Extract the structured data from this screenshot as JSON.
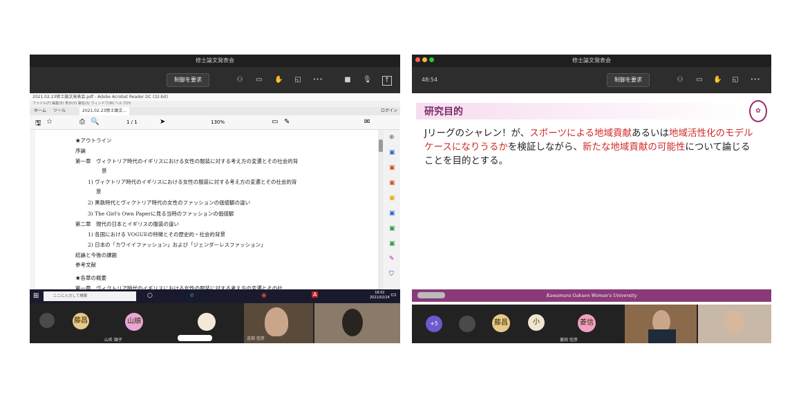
{
  "left": {
    "title": "修士論文発表会",
    "control_btn": "制御を要求",
    "pdf": {
      "strip1": "2021.02.23修士論文発表会.pdf - Adobe Acrobat Reader DC (32-bit)",
      "strip2": "ファイル(F) 編集(E) 表示(V) 署名(S) ウィンドウ(W) ヘルプ(H)",
      "tab_home": "ホーム",
      "tab_tool": "ツール",
      "tab_doc": "2021.02.23修士論文...",
      "login": "ログイン",
      "page": "1 / 1",
      "zoom": "130%",
      "lines": [
        "★アウトライン",
        "序論",
        "第一章　ヴィクトリア時代のイギリスにおける女性の服装に対する考え方の変遷とその社会的背",
        "景",
        "1) ヴィクトリア時代のイギリスにおける女性の服装に対する考え方の変遷とその社会的背",
        "景",
        "2) 黒鉄時代とヴィクトリア時代の女性のファッションの価値観の違い",
        "3) The Girl's Own Paperに見る当時のファッションの価値観",
        "第二章　現代の日本とイギリスの服装の違い",
        "1) 各国における VOGUEの特徴とその歴史的・社会的背景",
        "2) 日本の「カワイイファッション」および「ジェンダーレスファッション」",
        "結論と今後の課題",
        "参考文献",
        "",
        "★各章の概要",
        "第一章　ヴィクトリア時代のイギリスにおける女性の服装に対する考え方の変遷とその社"
      ]
    },
    "taskbar_search": "ここに入力して検索",
    "taskbar_time": "18:02",
    "taskbar_date": "2021/02/24",
    "participants": [
      {
        "initials": "藤昌"
      },
      {
        "initials": "山順",
        "name": "山名 順子"
      },
      {
        "initials": ""
      },
      {
        "name": "吉田 信彦"
      }
    ]
  },
  "right": {
    "title": "修士論文発表会",
    "timer": "48:54",
    "control_btn": "制御を要求",
    "slide": {
      "title": "研究目的",
      "body_1": "Jリーグのシャレン！が、",
      "body_red_1": "スポーツによる地域貢献",
      "body_2": "あるいは",
      "body_red_2": "地域活性化のモデルケースになりうるか",
      "body_3": "を検証しながら、",
      "body_red_3": "新たな地域貢献の可能性",
      "body_4": "について論じることを目的とする。",
      "footer": "Kawamura Gakuen Woman's University"
    },
    "participants": [
      {
        "initials": "+5"
      },
      {
        "initials": ""
      },
      {
        "initials": "藤昌"
      },
      {
        "initials": "小"
      },
      {
        "initials": "菱信",
        "name": "菱田 信彦"
      }
    ]
  }
}
